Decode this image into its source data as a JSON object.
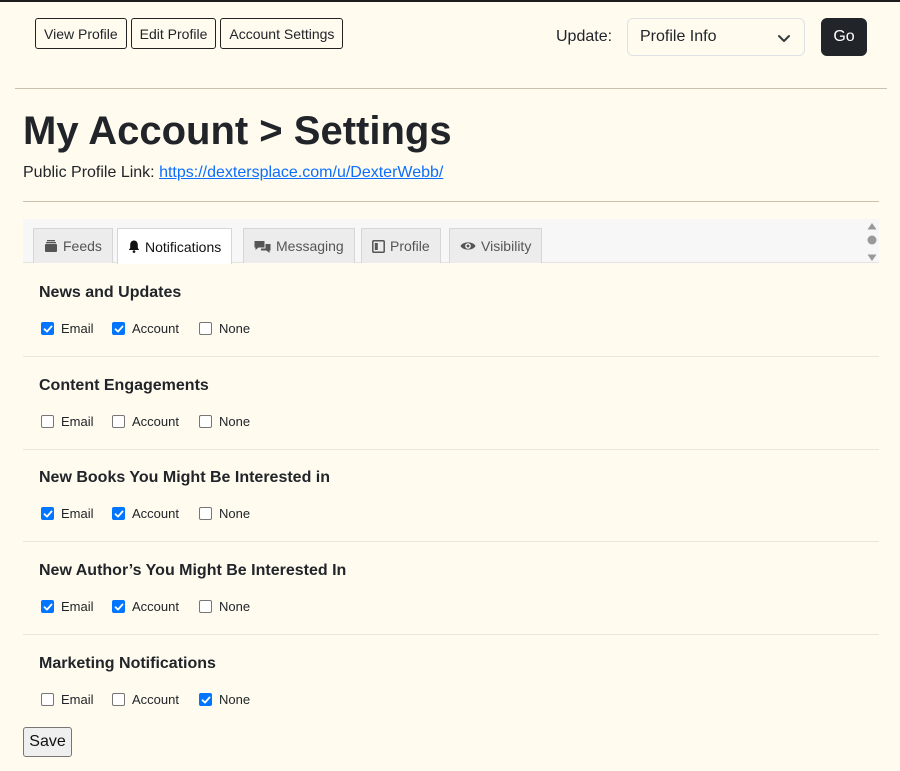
{
  "nav": {
    "buttons": [
      "View Profile",
      "Edit Profile",
      "Account Settings"
    ]
  },
  "update": {
    "label": "Update:",
    "selected": "Profile Info",
    "go_label": "Go"
  },
  "page": {
    "title": "My Account > Settings",
    "profile_link_label": "Public Profile Link:",
    "profile_link_url": "https://dextersplace.com/u/DexterWebb/"
  },
  "tabs": [
    {
      "label": "Feeds",
      "icon": "feeds-icon",
      "active": false
    },
    {
      "label": "Notifications",
      "icon": "bell-icon",
      "active": true
    },
    {
      "label": "Messaging",
      "icon": "chat-bubbles-icon",
      "active": false
    },
    {
      "label": "Profile",
      "icon": "profile-card-icon",
      "active": false
    },
    {
      "label": "Visibility",
      "icon": "eye-icon",
      "active": false
    }
  ],
  "option_labels": [
    "Email",
    "Account",
    "None"
  ],
  "sections": [
    {
      "title": "News and Updates",
      "email": true,
      "account": true,
      "none": false
    },
    {
      "title": "Content Engagements",
      "email": false,
      "account": false,
      "none": false
    },
    {
      "title": "New Books You Might Be Interested in",
      "email": true,
      "account": true,
      "none": false
    },
    {
      "title": "New Author’s You Might Be Interested In",
      "email": true,
      "account": true,
      "none": false
    },
    {
      "title": "Marketing Notifications",
      "email": false,
      "account": false,
      "none": true
    }
  ],
  "save_label": "Save",
  "colors": {
    "background": "#fffbef",
    "checkbox_checked": "#0075ff",
    "link": "#0d6efd",
    "go_button": "#212529"
  }
}
